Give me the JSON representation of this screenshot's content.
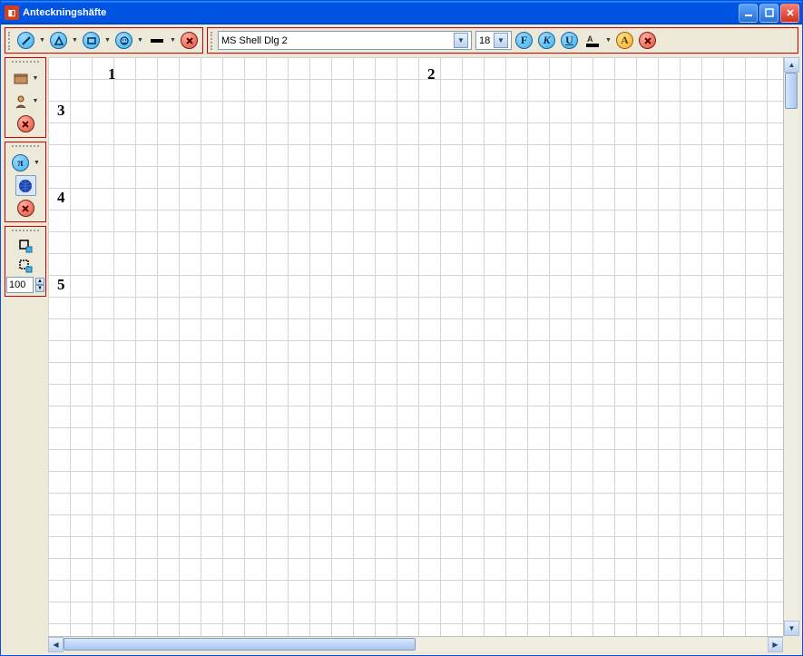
{
  "window": {
    "title": "Anteckningshäfte"
  },
  "toolbar_top_left": {
    "icons": [
      "line",
      "triangle",
      "rectangle",
      "face",
      "color",
      "close"
    ]
  },
  "toolbar_top_right": {
    "font_name": "MS Shell Dlg 2",
    "font_size": "18",
    "bold_glyph": "F",
    "italic_glyph": "K",
    "underline_glyph": "U"
  },
  "side_group_1": {
    "icons": [
      "book",
      "user",
      "close"
    ]
  },
  "side_group_2": {
    "icons": [
      "pi",
      "globe",
      "close"
    ]
  },
  "side_group_3": {
    "zoom_value": "100"
  },
  "grid_labels": {
    "l1": "1",
    "l2": "2",
    "l3": "3",
    "l4": "4",
    "l5": "5"
  }
}
